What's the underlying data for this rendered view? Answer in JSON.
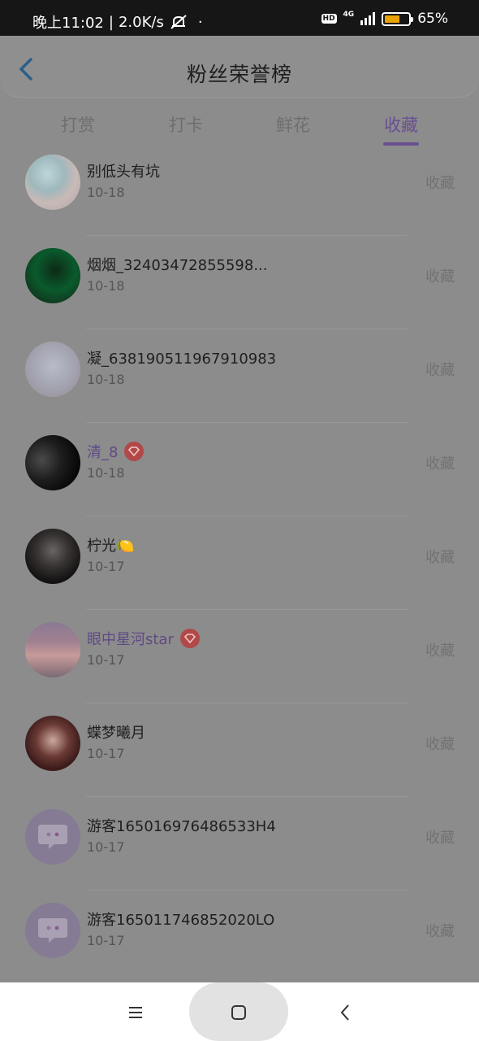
{
  "status_bar": {
    "time": "晚上11:02",
    "separator": "|",
    "net_speed": "2.0K/s",
    "dot": "·",
    "hd_label": "HD",
    "network_type": "4G",
    "battery_percent": "65%",
    "battery_level": 0.65
  },
  "header": {
    "title": "粉丝荣誉榜",
    "back_icon": "chevron-left-icon"
  },
  "tabs": [
    {
      "label": "打赏",
      "active": false
    },
    {
      "label": "打卡",
      "active": false
    },
    {
      "label": "鲜花",
      "active": false
    },
    {
      "label": "收藏",
      "active": true
    }
  ],
  "fans": [
    {
      "name": "别低头有坑",
      "date": "10-18",
      "action": "收藏",
      "vip": false
    },
    {
      "name": "烟烟_32403472855598...",
      "date": "10-18",
      "action": "收藏",
      "vip": false
    },
    {
      "name": "凝_638190511967910983",
      "date": "10-18",
      "action": "收藏",
      "vip": false
    },
    {
      "name": "清_8",
      "date": "10-18",
      "action": "收藏",
      "vip": true
    },
    {
      "name": "柠光🍋",
      "date": "10-17",
      "action": "收藏",
      "vip": false
    },
    {
      "name": "眼中星河star",
      "date": "10-17",
      "action": "收藏",
      "vip": true
    },
    {
      "name": "蝶梦曦月",
      "date": "10-17",
      "action": "收藏",
      "vip": false
    },
    {
      "name": "游客165016976486533H4",
      "date": "10-17",
      "action": "收藏",
      "vip": false
    },
    {
      "name": "游客165011746852020LO",
      "date": "10-17",
      "action": "收藏",
      "vip": false
    }
  ],
  "navbar": {
    "menu_icon": "menu-icon",
    "home_icon": "home-square-icon",
    "back_icon": "back-chevron-icon"
  },
  "colors": {
    "accent": "#6a4f92",
    "vip_badge": "#b24848"
  }
}
